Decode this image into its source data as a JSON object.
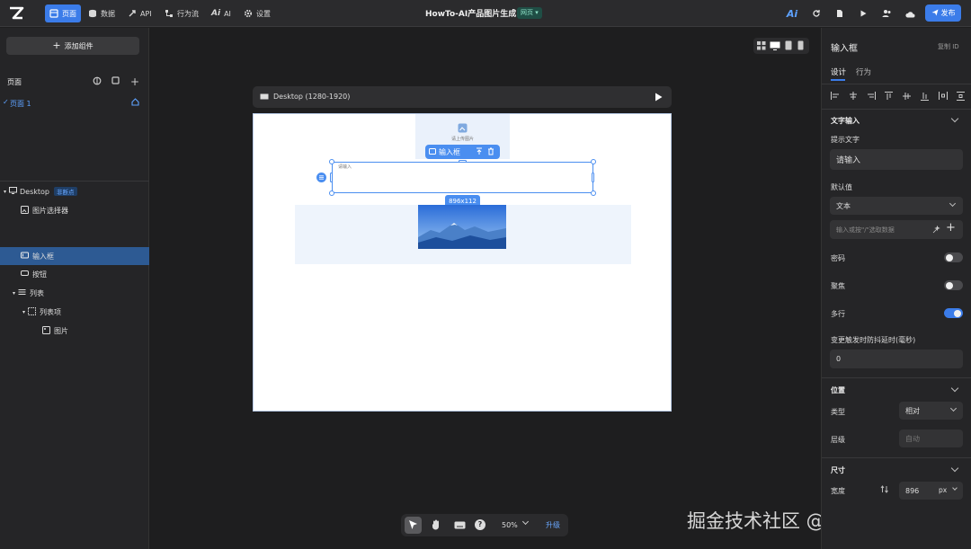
{
  "topbar": {
    "nav": [
      "页面",
      "数据",
      "API",
      "行为流",
      "AI",
      "设置"
    ],
    "project_title": "HowTo-AI产品图片生成",
    "project_badge": "网页",
    "publish_label": "发布"
  },
  "left_panel": {
    "add_component_label": "添加组件",
    "pages_title": "页面",
    "page_item": "页面 1",
    "tree": [
      {
        "label": "Desktop",
        "badge": "非断点"
      },
      {
        "label": "图片选择器"
      },
      {
        "label": "输入框"
      },
      {
        "label": "按钮"
      },
      {
        "label": "列表"
      },
      {
        "label": "列表项"
      },
      {
        "label": "图片"
      }
    ]
  },
  "canvas": {
    "device_label": "Desktop (1280-1920)",
    "image_upload_hint": "请上传图片",
    "component_toolbar_label": "输入框",
    "input_placeholder": "请输入",
    "size_badge": "896x112"
  },
  "bottom_toolbar": {
    "zoom": "50%",
    "upgrade_label": "升级"
  },
  "right_panel": {
    "title": "输入框",
    "copy_id_label": "复制 ID",
    "tabs": [
      "设计",
      "行为"
    ],
    "text_input_section": "文字输入",
    "hint_label": "提示文字",
    "hint_value": "请输入",
    "default_label": "默认值",
    "default_type": "文本",
    "default_placeholder": "输入或按\"/\"选取数据",
    "password_label": "密码",
    "password_on": false,
    "focus_label": "聚焦",
    "focus_on": false,
    "multiline_label": "多行",
    "multiline_on": true,
    "debounce_label": "变更触发时防抖延时(毫秒)",
    "debounce_value": "0",
    "position_section": "位置",
    "type_label": "类型",
    "type_value": "相对",
    "zindex_label": "层级",
    "zindex_placeholder": "自动",
    "size_section": "尺寸",
    "width_label": "宽度",
    "width_value": "896",
    "width_unit": "px"
  },
  "watermark": "掘金技术社区 @ 代码青铜z",
  "colors": {
    "accent": "#3b7ce9",
    "panel": "#252527",
    "canvas": "#1e1e1f"
  }
}
